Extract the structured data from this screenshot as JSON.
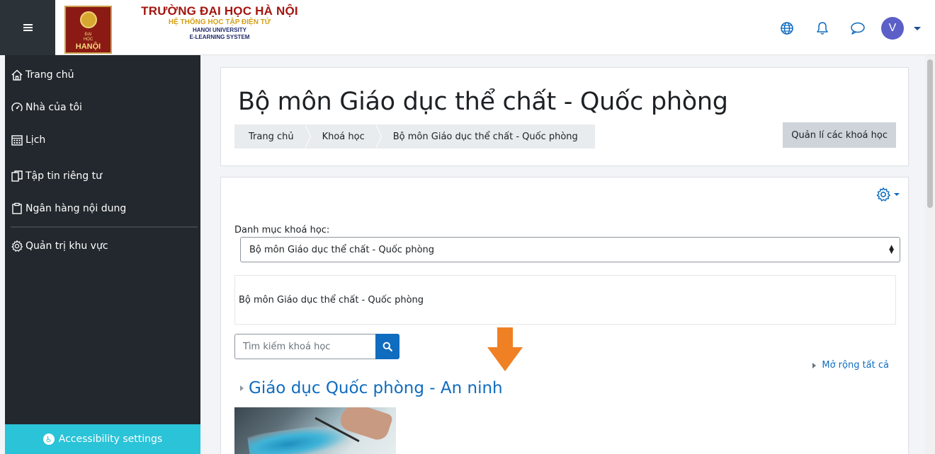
{
  "header": {
    "logo": {
      "line1": "ĐẠI",
      "line2": "HỌC",
      "line3": "HANỘI"
    },
    "brand_line1": "TRƯỜNG ĐẠI HỌC HÀ NỘI",
    "brand_line2": "HỆ THỐNG HỌC TẬP ĐIỆN TỬ",
    "brand_line3": "HANOI UNIVERSITY",
    "brand_line4": "E-LEARNING SYSTEM",
    "icons": [
      "globe-icon",
      "bell-icon",
      "chat-icon"
    ],
    "avatar_initial": "V"
  },
  "sidebar": {
    "items": [
      {
        "label": "Trang chủ",
        "icon": "home-icon"
      },
      {
        "label": "Nhà của tôi",
        "icon": "dashboard-icon"
      },
      {
        "label": "Lịch",
        "icon": "calendar-icon"
      },
      {
        "label": "Tập tin riêng tư",
        "icon": "files-icon"
      },
      {
        "label": "Ngân hàng nội dung",
        "icon": "clipboard-icon"
      },
      {
        "label": "Quản trị khu vực",
        "icon": "gear-icon"
      }
    ],
    "accessibility_label": "Accessibility settings"
  },
  "page": {
    "title": "Bộ môn Giáo dục thể chất - Quốc phòng",
    "breadcrumb": [
      "Trang chủ",
      "Khoá học",
      "Bộ môn Giáo dục thể chất - Quốc phòng"
    ],
    "manage_button": "Quản lí các khoá học"
  },
  "main": {
    "category_label": "Danh mục khoá học:",
    "category_selected": "Bộ môn Giáo dục thể chất - Quốc phòng",
    "description": "Bộ môn Giáo dục thể chất - Quốc phòng",
    "search_placeholder": "Tìm kiếm khoá học",
    "expand_all": "Mở rộng tất cả",
    "course_title": "Giáo dục Quốc phòng - An ninh"
  },
  "colors": {
    "sidebar_bg": "#22282d",
    "accent": "#0f6cbf",
    "accessibility_bg": "#2ac3d8",
    "arrow": "#f08024",
    "brand_red": "#a3160f"
  }
}
